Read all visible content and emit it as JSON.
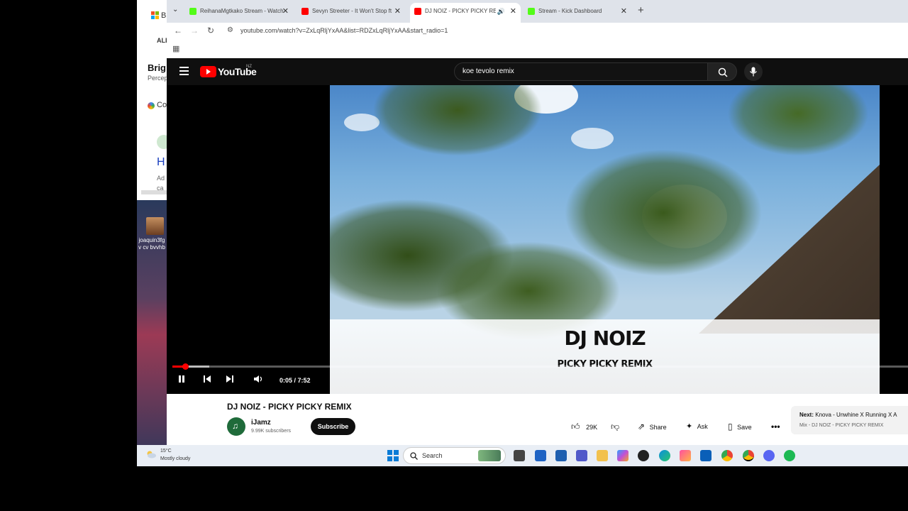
{
  "background_window": {
    "title_fragment": "B",
    "tab_label": "ALL",
    "heading": "Brig",
    "subheading": "Percep",
    "co_label": "Co",
    "big_letter": "H",
    "line1": "Ad",
    "line2": "ca"
  },
  "desktop": {
    "icon_label": "joaquin3fg v cv bvvhb"
  },
  "browser": {
    "tabs": [
      {
        "label": "ReihanaMgtkako Stream - Watch",
        "favicon_color": "#53fc18"
      },
      {
        "label": "Sevyn Streeter - It Won't Stop ft",
        "favicon_color": "#ff0000"
      },
      {
        "label": "DJ NOIZ - PICKY PICKY REMIX",
        "favicon_color": "#ff0000"
      },
      {
        "label": "Stream - Kick Dashboard",
        "favicon_color": "#53fc18"
      }
    ],
    "url": "youtube.com/watch?v=ZxLqRljYxAA&list=RDZxLqRljYxAA&start_radio=1"
  },
  "youtube": {
    "logo_text": "YouTube",
    "country": "NZ",
    "search_query": "koe tevolo remix",
    "video_title_overlay": "DJ NOIZ",
    "video_subtitle_overlay": "PICKY PICKY REMIX",
    "time_display": "0:05 / 7:52",
    "progress_fraction": 0.011,
    "video_title": "DJ NOIZ - PICKY PICKY REMIX",
    "channel_name": "iJamz",
    "subscribers": "9.99K subscribers",
    "subscribe_label": "Subscribe",
    "like_count": "29K",
    "share_label": "Share",
    "ask_label": "Ask",
    "save_label": "Save",
    "next_prefix": "Next:",
    "next_title": "Knova - Unwhine X Running X A",
    "next_mix": "Mix - DJ NOIZ - PICKY PICKY REMIX",
    "accent": "#ff0000"
  },
  "taskbar": {
    "temperature": "15°C",
    "condition": "Mostly cloudy",
    "search_placeholder": "Search"
  }
}
